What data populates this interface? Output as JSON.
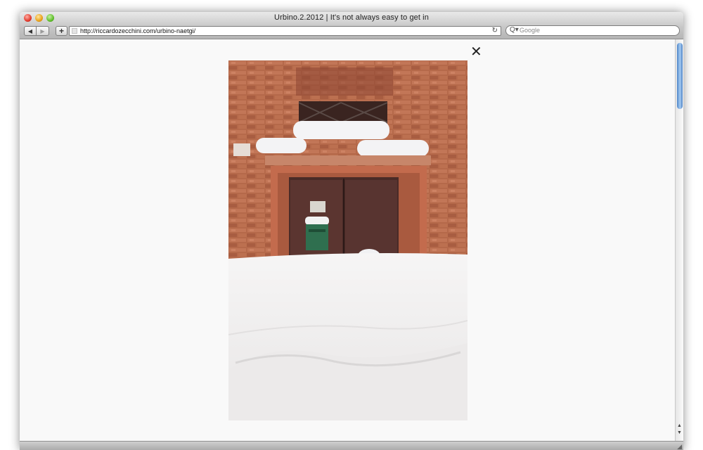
{
  "window": {
    "title": "Urbino.2.2012 | It's not always easy to get in"
  },
  "toolbar": {
    "back_icon": "◀",
    "forward_icon": "▶",
    "add_icon": "+",
    "url": "http://riccardozecchini.com/urbino-naetgi/",
    "reload_icon": "↻",
    "search_placeholder": "Google",
    "search_icon_glyph": "Q▾"
  },
  "lightbox": {
    "close_glyph": "✕",
    "photo_alt": "Wooden door in a red brick wall, half buried in snow"
  },
  "scrollbar": {
    "up_glyph": "▲",
    "down_glyph": "▼"
  }
}
